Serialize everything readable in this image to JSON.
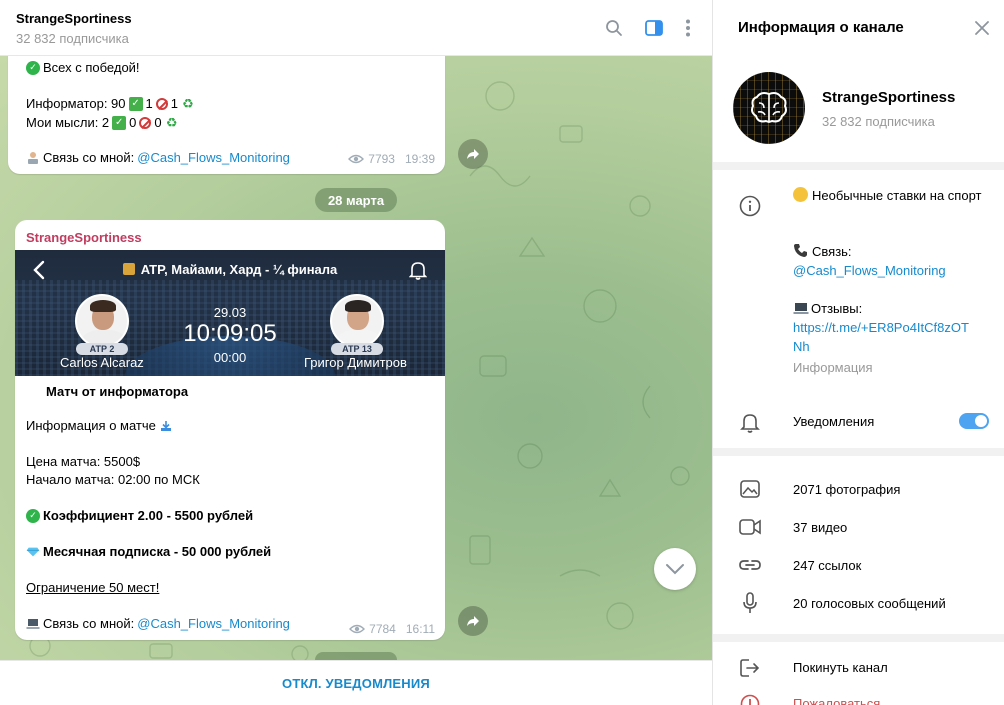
{
  "chat": {
    "title": "StrangeSportiness",
    "subscribers": "32 832 подписчика",
    "date_divider": "28 марта",
    "footer_button": "ОТКЛ. УВЕДОМЛЕНИЯ"
  },
  "msg1": {
    "win_text": "Всех с победой!",
    "informer_label": "Информатор: 90",
    "informer_a": "1",
    "informer_b": "1",
    "mine_label": "Мои мысли: 2",
    "mine_a": "0",
    "mine_b": "0",
    "contact_label": "Связь со мной:",
    "contact_link": "@Cash_Flows_Monitoring",
    "views": "7793",
    "time": "19:39"
  },
  "msg2": {
    "author": "StrangeSportiness",
    "card": {
      "tournament": "ATP, Майами, Хард - ¼ финала",
      "date": "29.03",
      "time": "10:09:05",
      "timer": "00:00",
      "player1_rank": "ATP 2",
      "player1_name": "Carlos Alcaraz",
      "player2_rank": "ATP 13",
      "player2_name": "Григор Димитров"
    },
    "heading": "Матч от информатора",
    "info": "Информация о матче",
    "price": "Цена матча: 5500$",
    "start": "Начало матча: 02:00 по МСК",
    "coef": "Коэффициент 2.00 - 5500 рублей",
    "sub": "Месячная подписка - 50 000 рублей",
    "limit": "Ограничение 50 мест!",
    "contact_label": "Связь со мной:",
    "contact_link": "@Cash_Flows_Monitoring",
    "views": "7784",
    "time": "16:11"
  },
  "info": {
    "title": "Информация о канале",
    "name": "StrangeSportiness",
    "subscribers": "32 832 подписчика",
    "desc_line": "Необычные ставки на спорт",
    "contact_label": "Связь:",
    "contact_link": "@Cash_Flows_Monitoring",
    "reviews_label": "Отзывы:",
    "reviews_link_a": "https://t.me/+ER8Po4ItCf8zOT",
    "reviews_link_b": "Nh",
    "about_label": "Информация",
    "notifications": "Уведомления",
    "notifications_on": true,
    "media": [
      {
        "label": "2071 фотография",
        "icon": "photo-icon"
      },
      {
        "label": "37 видео",
        "icon": "video-icon"
      },
      {
        "label": "247 ссылок",
        "icon": "link-icon"
      },
      {
        "label": "20 голосовых сообщений",
        "icon": "microphone-icon"
      }
    ],
    "leave": "Покинуть канал",
    "report": "Пожаловаться"
  },
  "colors": {
    "accent": "#168acd",
    "author": "#c03d5f",
    "report": "#d14e4e",
    "toggle": "#4ea4f0"
  }
}
